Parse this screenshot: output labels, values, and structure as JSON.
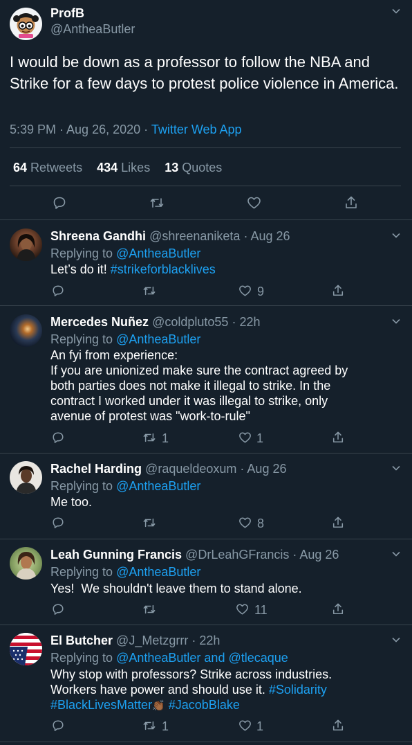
{
  "main_tweet": {
    "display_name": "ProfB",
    "handle": "@AntheaButler",
    "text": "I would be down as a professor to follow the NBA and Strike for a few days to protest police violence in America.",
    "time": "5:39 PM · Aug 26, 2020 · ",
    "source": "Twitter Web App",
    "stats": {
      "retweets_count": "64",
      "retweets_label": "Retweets",
      "likes_count": "434",
      "likes_label": "Likes",
      "quotes_count": "13",
      "quotes_label": "Quotes"
    }
  },
  "replies": [
    {
      "name": "Shreena Gandhi",
      "handle": "@shreenaniketa",
      "time": "· Aug 26",
      "replying_label": "Replying to",
      "replying_to": "@AntheaButler",
      "text_plain": "Let’s do it!",
      "hashtag": "#strikeforblacklives",
      "retweet_count": "",
      "like_count": "9"
    },
    {
      "name": "Mercedes Nuñez",
      "handle": "@coldpluto55",
      "time": "· 22h",
      "replying_label": "Replying to",
      "replying_to": "@AntheaButler",
      "lines": [
        "An fyi from experience:",
        "If you are unionized make sure the contract agreed by",
        "both parties does not make it illegal to strike. In the",
        "contract I worked under it was illegal to strike, only",
        "avenue of protest was \"work-to-rule\""
      ],
      "retweet_count": "1",
      "like_count": "1"
    },
    {
      "name": "Rachel Harding",
      "handle": "@raqueldeoxum",
      "time": "· Aug 26",
      "replying_label": "Replying to",
      "replying_to": "@AntheaButler",
      "text": "Me too.",
      "retweet_count": "",
      "like_count": "8"
    },
    {
      "name": "Leah Gunning Francis",
      "handle": "@DrLeahGFrancis",
      "time": "· Aug 26",
      "replying_label": "Replying to",
      "replying_to": "@AntheaButler",
      "text": "Yes!  We shouldn't leave them to stand alone.",
      "retweet_count": "",
      "like_count": "11"
    },
    {
      "name": "El Butcher",
      "handle": "@J_Metzgrrr",
      "time": "· 22h",
      "replying_label": "Replying to",
      "replying_to": "@AntheaButler and @tlecaque",
      "line1": "Why stop with professors? Strike across industries.",
      "line2_plain": "Workers have power and should use it.",
      "line2_hashtag": "#Solidarity",
      "line3_hashtag_a": "#BlackLivesMatter",
      "line3_emoji": "👏🏾",
      "line3_hashtag_b": "#JacobBlake",
      "retweet_count": "1",
      "like_count": "1"
    }
  ],
  "colors": {
    "background": "#15202b",
    "text": "#ffffff",
    "muted": "#8899a6",
    "link": "#1da1f2",
    "divider": "#38444d"
  }
}
